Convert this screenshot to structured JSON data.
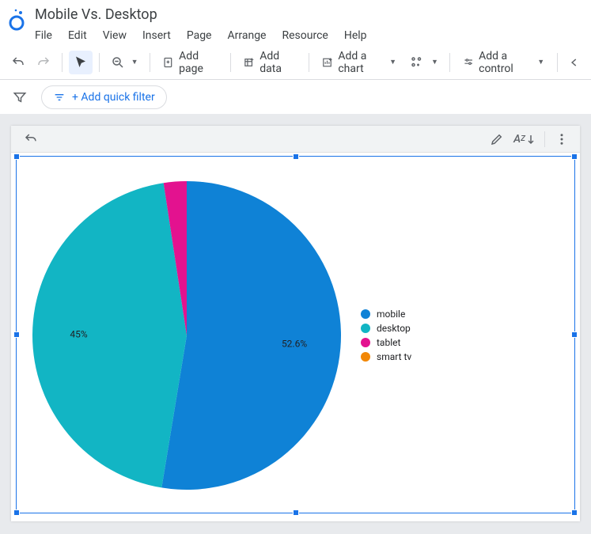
{
  "header": {
    "doc_title": "Mobile Vs. Desktop",
    "menu": [
      "File",
      "Edit",
      "View",
      "Insert",
      "Page",
      "Arrange",
      "Resource",
      "Help"
    ]
  },
  "toolbar": {
    "add_page": "Add page",
    "add_data": "Add data",
    "add_chart": "Add a chart",
    "add_control": "Add a control"
  },
  "filterbar": {
    "quick_filter": "+ Add quick filter"
  },
  "chart_data": {
    "type": "pie",
    "title": "",
    "series": [
      {
        "name": "mobile",
        "value": 52.6,
        "color": "#0f82d6",
        "label": "52.6%"
      },
      {
        "name": "desktop",
        "value": 45.0,
        "color": "#12b5c4",
        "label": "45%"
      },
      {
        "name": "tablet",
        "value": 2.4,
        "color": "#e3128f",
        "label": ""
      },
      {
        "name": "smart tv",
        "value": 0.0,
        "color": "#f28705",
        "label": ""
      }
    ],
    "legend_position": "right"
  }
}
